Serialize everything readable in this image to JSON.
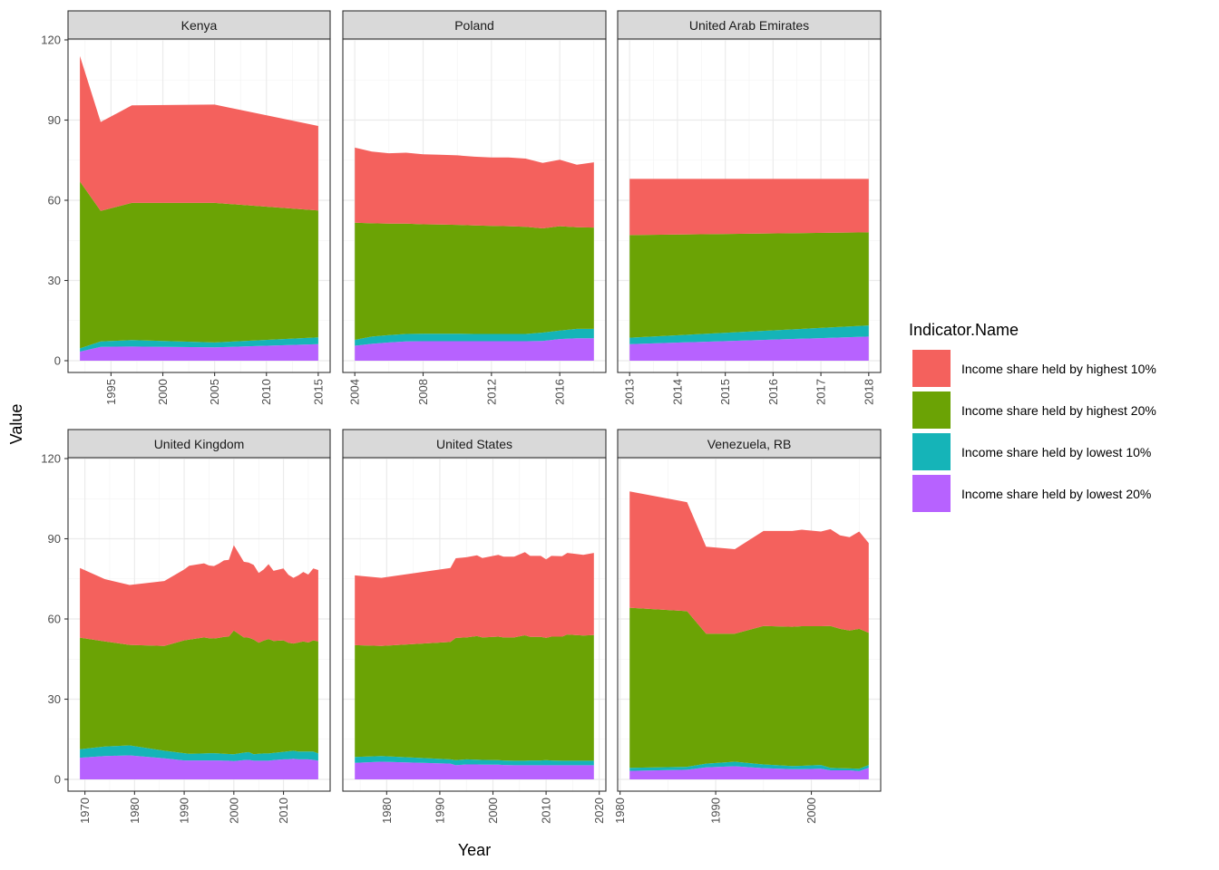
{
  "chart_data": {
    "type": "area",
    "stacked": true,
    "xlabel": "Year",
    "ylabel": "Value",
    "y_ticks": [
      0,
      30,
      60,
      90,
      120
    ],
    "grid": true,
    "legend": {
      "title": "Indicator.Name",
      "placement": "right",
      "entries": [
        {
          "key": "high10",
          "label": "Income share held by highest 10%",
          "color": "#F4615D"
        },
        {
          "key": "high20",
          "label": "Income share held by highest 20%",
          "color": "#6BA305"
        },
        {
          "key": "low10",
          "label": "Income share held by lowest 10%",
          "color": "#15B4B8"
        },
        {
          "key": "low20",
          "label": "Income share held by lowest 20%",
          "color": "#B762FF"
        }
      ]
    },
    "stack_order_bottom_to_top": [
      "low20",
      "low10",
      "high20",
      "high10"
    ],
    "panels": [
      {
        "title": "Kenya",
        "x_ticks": [
          1995,
          2000,
          2005,
          2010,
          2015
        ],
        "years": [
          1992,
          1994,
          1997,
          2005,
          2015
        ],
        "series": {
          "low20": [
            3.4,
            5.2,
            5.3,
            5.0,
            6.2
          ],
          "low10": [
            1.2,
            2.0,
            2.4,
            1.8,
            2.5
          ],
          "high20": [
            62.4,
            48.8,
            51.3,
            52.2,
            47.5
          ],
          "high10": [
            47.0,
            33.3,
            36.5,
            36.8,
            31.6
          ]
        }
      },
      {
        "title": "Poland",
        "x_ticks": [
          2004,
          2008,
          2012,
          2016
        ],
        "years": [
          2004,
          2005,
          2006,
          2007,
          2008,
          2009,
          2010,
          2011,
          2012,
          2013,
          2014,
          2015,
          2016,
          2017,
          2018
        ],
        "series": {
          "low20": [
            5.6,
            6.3,
            6.8,
            7.2,
            7.3,
            7.3,
            7.3,
            7.3,
            7.3,
            7.3,
            7.3,
            7.4,
            8.1,
            8.4,
            8.4
          ],
          "low10": [
            2.2,
            2.7,
            2.8,
            2.8,
            2.8,
            2.8,
            2.8,
            2.7,
            2.7,
            2.7,
            2.7,
            3.1,
            3.2,
            3.5,
            3.5
          ],
          "high20": [
            43.8,
            42.4,
            41.7,
            41.3,
            40.9,
            40.8,
            40.7,
            40.6,
            40.4,
            40.3,
            40.1,
            39.0,
            39.0,
            38.0,
            37.9
          ],
          "high10": [
            28.1,
            26.8,
            26.3,
            26.5,
            26.2,
            26.1,
            26.0,
            25.7,
            25.6,
            25.7,
            25.5,
            24.5,
            24.9,
            23.4,
            24.4
          ]
        }
      },
      {
        "title": "United Arab Emirates",
        "x_ticks": [
          2013,
          2014,
          2015,
          2016,
          2017,
          2018
        ],
        "years": [
          2013,
          2018
        ],
        "series": {
          "low20": [
            6.2,
            9.0
          ],
          "low10": [
            2.4,
            4.2
          ],
          "high20": [
            38.4,
            34.8
          ],
          "high10": [
            21.0,
            20.0
          ]
        }
      },
      {
        "title": "United Kingdom",
        "x_ticks": [
          1970,
          1980,
          1990,
          2000,
          2010
        ],
        "years": [
          1969,
          1974,
          1979,
          1986,
          1990,
          1991,
          1994,
          1995,
          1996,
          1997,
          1998,
          1999,
          2000,
          2002,
          2003,
          2004,
          2005,
          2006,
          2007,
          2008,
          2010,
          2011,
          2012,
          2013,
          2014,
          2015,
          2016,
          2017
        ],
        "series": {
          "low20": [
            8.1,
            8.7,
            9.0,
            7.9,
            7.1,
            7.1,
            7.1,
            7.1,
            7.1,
            7.1,
            7.0,
            7.0,
            6.8,
            7.2,
            7.3,
            7.0,
            7.0,
            7.0,
            7.0,
            7.2,
            7.5,
            7.5,
            7.7,
            7.5,
            7.5,
            7.5,
            7.3,
            7.0
          ],
          "low10": [
            3.2,
            3.6,
            3.7,
            2.8,
            2.7,
            2.5,
            2.6,
            2.7,
            2.7,
            2.6,
            2.6,
            2.5,
            2.6,
            2.8,
            2.9,
            2.4,
            2.6,
            2.7,
            2.7,
            2.7,
            2.8,
            3.0,
            3.0,
            2.9,
            2.9,
            2.9,
            3.1,
            2.7
          ],
          "high20": [
            41.7,
            39.3,
            37.6,
            39.2,
            42.2,
            42.7,
            43.4,
            43.0,
            42.9,
            43.2,
            43.7,
            43.9,
            46.3,
            43.1,
            42.8,
            42.9,
            41.5,
            42.2,
            42.8,
            41.9,
            41.7,
            40.6,
            40.1,
            40.8,
            41.2,
            40.8,
            41.6,
            41.9
          ],
          "high10": [
            26.1,
            23.3,
            22.4,
            24.3,
            26.5,
            27.6,
            27.7,
            27.2,
            27.1,
            27.8,
            28.6,
            28.7,
            31.9,
            28.3,
            28.1,
            27.9,
            26.1,
            26.6,
            28.0,
            26.2,
            26.9,
            25.4,
            24.6,
            25.1,
            26.0,
            25.4,
            26.9,
            26.7
          ]
        }
      },
      {
        "title": "United States",
        "x_ticks": [
          1980,
          1990,
          2000,
          2010,
          2020
        ],
        "years": [
          1974,
          1979,
          1992,
          1993,
          1995,
          1997,
          1998,
          2001,
          2002,
          2004,
          2006,
          2007,
          2009,
          2010,
          2011,
          2013,
          2014,
          2017,
          2019
        ],
        "series": {
          "low20": [
            6.2,
            6.6,
            5.9,
            5.3,
            5.6,
            5.6,
            5.5,
            5.5,
            5.4,
            5.3,
            5.3,
            5.3,
            5.3,
            5.3,
            5.3,
            5.3,
            5.3,
            5.3,
            5.3
          ],
          "low10": [
            2.2,
            2.1,
            1.6,
            1.9,
            1.9,
            1.8,
            1.8,
            1.7,
            1.7,
            1.7,
            1.7,
            1.8,
            1.8,
            1.9,
            1.8,
            1.7,
            1.7,
            1.7,
            1.7
          ],
          "high20": [
            41.8,
            41.2,
            43.9,
            45.7,
            45.6,
            46.2,
            45.8,
            46.2,
            46.0,
            46.1,
            46.9,
            46.2,
            46.2,
            45.7,
            46.3,
            46.4,
            47.2,
            46.8,
            47.0
          ],
          "high10": [
            26.1,
            25.5,
            27.7,
            29.8,
            30.0,
            30.2,
            29.7,
            30.6,
            30.2,
            30.2,
            31.1,
            30.3,
            30.3,
            29.4,
            30.2,
            30.1,
            30.5,
            30.2,
            30.7
          ]
        }
      },
      {
        "title": "Venezuela, RB",
        "x_ticks": [
          1980,
          1990,
          2000
        ],
        "years": [
          1981,
          1987,
          1989,
          1992,
          1995,
          1998,
          1999,
          2001,
          2002,
          2003,
          2004,
          2005,
          2006
        ],
        "series": {
          "low20": [
            3.2,
            3.6,
            4.5,
            4.9,
            4.2,
            3.8,
            3.8,
            4.0,
            3.4,
            3.4,
            3.4,
            3.1,
            4.3
          ],
          "low10": [
            1.1,
            1.1,
            1.4,
            1.7,
            1.4,
            1.2,
            1.3,
            1.4,
            0.9,
            0.8,
            0.7,
            0.9,
            1.1
          ],
          "high20": [
            59.9,
            58.2,
            48.6,
            47.9,
            51.8,
            52.1,
            52.2,
            51.9,
            53.1,
            52.1,
            51.6,
            52.3,
            49.4
          ],
          "high10": [
            43.5,
            40.8,
            32.5,
            31.6,
            35.5,
            35.8,
            36.1,
            35.4,
            36.2,
            35.0,
            34.9,
            36.4,
            33.6
          ]
        }
      }
    ]
  }
}
